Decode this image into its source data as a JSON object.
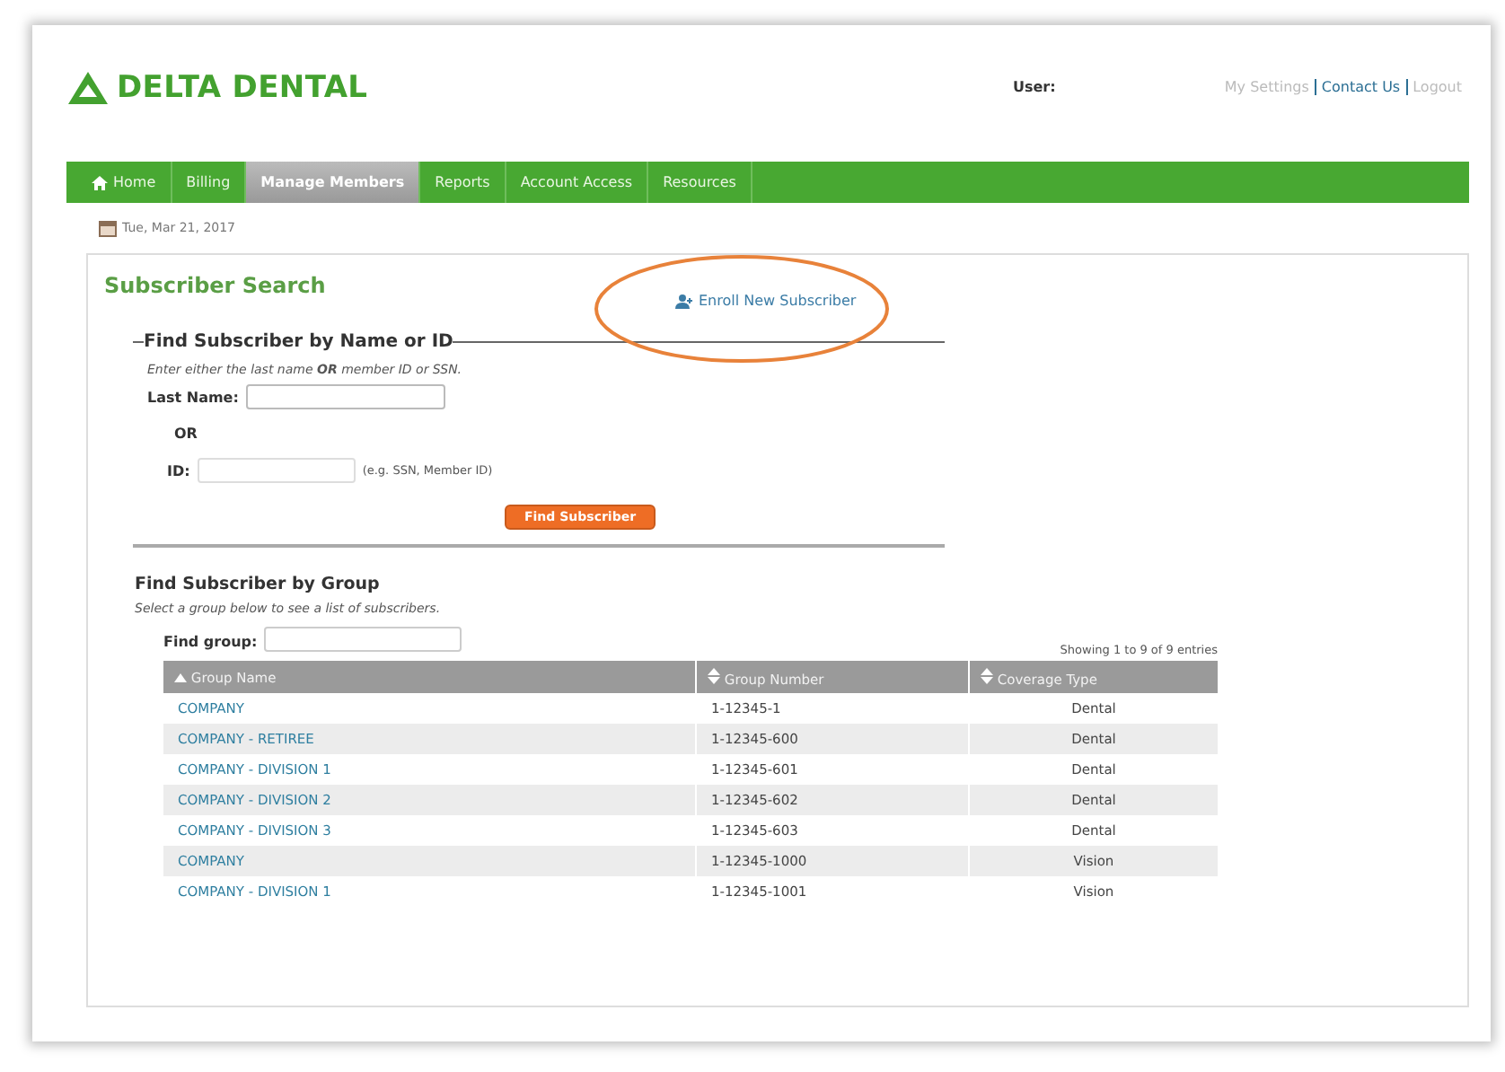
{
  "header": {
    "logo": "DELTA DENTAL",
    "user_label": "User:",
    "links": [
      {
        "label": "My Settings",
        "selected": false
      },
      {
        "label": "Contact Us",
        "selected": true
      },
      {
        "label": "Logout",
        "selected": false
      }
    ]
  },
  "nav": [
    {
      "label": "Home",
      "kind": "home",
      "selected": false
    },
    {
      "label": "Billing",
      "kind": "plain",
      "selected": false
    },
    {
      "label": "Manage Members",
      "kind": "plain",
      "selected": true
    },
    {
      "label": "Reports",
      "kind": "plain",
      "selected": false
    },
    {
      "label": "Account Access",
      "kind": "plain",
      "selected": false
    },
    {
      "label": "Resources",
      "kind": "plain",
      "selected": false
    }
  ],
  "date": "Tue, Mar 21, 2017",
  "panel": {
    "title": "Subscriber Search",
    "enroll_link": "Enroll New Subscriber",
    "by_name": {
      "legend": "Find Subscriber by Name or ID",
      "hint": "Enter either the last name **OR** member ID or SSN.",
      "last_name_label": "Last Name:",
      "or_label": "OR",
      "id_label": "ID:",
      "id_hint": "(e.g. SSN, Member ID)",
      "button": "Find Subscriber"
    },
    "by_group": {
      "title": "Find Subscriber by Group",
      "hint": "Select a group below to see a list of subscribers.",
      "find_label": "Find group:",
      "showing": "Showing 1 to 9 of 9 entries",
      "columns": [
        {
          "label": "Group Name",
          "sorted": true
        },
        {
          "label": "Group Number",
          "sorted": false
        },
        {
          "label": "Coverage Type",
          "sorted": false
        }
      ],
      "rows": [
        [
          "COMPANY",
          "1-12345-1",
          "Dental"
        ],
        [
          "COMPANY - RETIREE",
          "1-12345-600",
          "Dental"
        ],
        [
          "COMPANY - DIVISION 1",
          "1-12345-601",
          "Dental"
        ],
        [
          "COMPANY - DIVISION 2",
          "1-12345-602",
          "Dental"
        ],
        [
          "COMPANY - DIVISION 3",
          "1-12345-603",
          "Dental"
        ],
        [
          "COMPANY",
          "1-12345-1000",
          "Vision"
        ],
        [
          "COMPANY - DIVISION 1",
          "1-12345-1001",
          "Vision"
        ]
      ]
    }
  }
}
